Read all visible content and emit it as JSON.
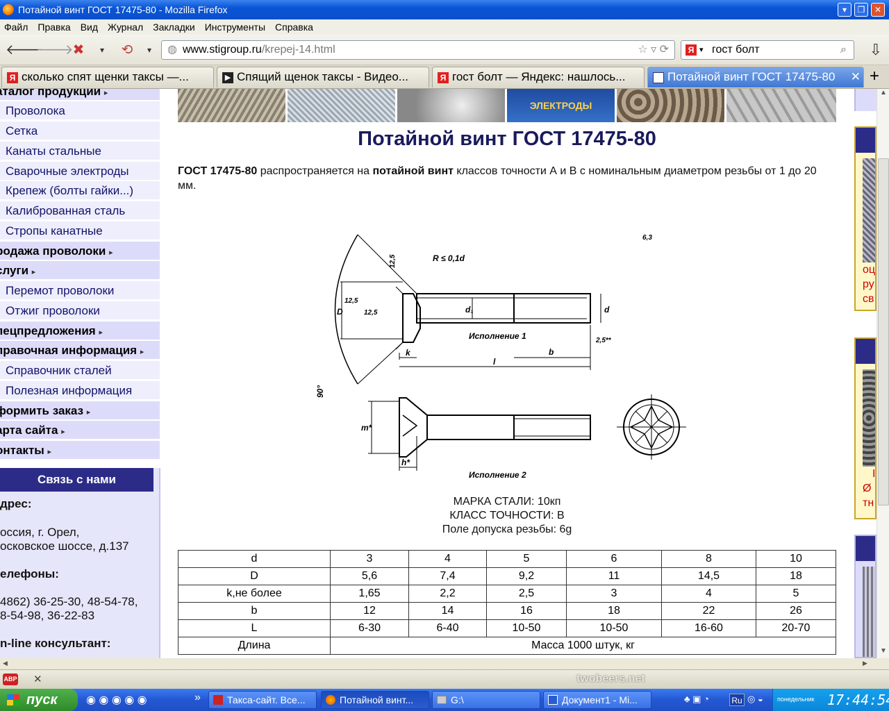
{
  "window": {
    "title": "Потайной винт ГОСТ 17475-80 - Mozilla Firefox"
  },
  "menu": [
    "Файл",
    "Правка",
    "Вид",
    "Журнал",
    "Закладки",
    "Инструменты",
    "Справка"
  ],
  "url": {
    "domain": "www.stigroup.ru",
    "path": "/krepej-14.html"
  },
  "search": {
    "value": "гост болт",
    "engine_glyph": "Я"
  },
  "tabs": [
    {
      "label": "сколько спят щенки таксы —..."
    },
    {
      "label": "Спящий щенок таксы - Видео..."
    },
    {
      "label": "гост болт — Яндекс: нашлось..."
    },
    {
      "label": "Потайной винт ГОСТ 17475-80"
    }
  ],
  "sidebar": [
    {
      "label": "аталог продукции",
      "type": "head"
    },
    {
      "label": "Проволока",
      "type": "sub"
    },
    {
      "label": "Сетка",
      "type": "sub"
    },
    {
      "label": "Канаты стальные",
      "type": "sub"
    },
    {
      "label": "Сварочные электроды",
      "type": "sub"
    },
    {
      "label": "Крепеж (болты гайки...)",
      "type": "sub"
    },
    {
      "label": "Калиброванная сталь",
      "type": "sub"
    },
    {
      "label": "Стропы канатные",
      "type": "sub"
    },
    {
      "label": "родажа проволоки",
      "type": "head"
    },
    {
      "label": "слуги",
      "type": "head"
    },
    {
      "label": "Перемот проволоки",
      "type": "sub"
    },
    {
      "label": "Отжиг проволоки",
      "type": "sub"
    },
    {
      "label": "пецпредложения",
      "type": "head"
    },
    {
      "label": "правочная информация",
      "type": "head"
    },
    {
      "label": "Справочник сталей",
      "type": "sub"
    },
    {
      "label": "Полезная информация",
      "type": "sub"
    },
    {
      "label": "формить заказ",
      "type": "head"
    },
    {
      "label": "арта сайта",
      "type": "head"
    },
    {
      "label": "онтакты",
      "type": "head"
    }
  ],
  "contact": {
    "heading": "Связь с нами",
    "address_label": "дрес:",
    "address_line1": "оссия, г. Орел,",
    "address_line2": "осковское шоссе, д.137",
    "phones_label": "елефоны:",
    "phones_line1": "4862) 36-25-30, 48-54-78,",
    "phones_line2": "8-54-98, 36-22-83",
    "online_label": "n-line консультант:"
  },
  "banner": {
    "electrode_text": "ЭЛЕКТРОДЫ"
  },
  "main": {
    "title": "Потайной винт ГОСТ 17475-80",
    "intro_b1": "ГОСТ 17475-80",
    "intro_t1": " распространяется на ",
    "intro_b2": "потайной винт",
    "intro_t2": " классов точности А и В с номинальным диаметром резьбы от 1 до 20 мм.",
    "steel": "МАРКА СТАЛИ: 10кп",
    "accuracy": "КЛАСС ТОЧНОСТИ: В",
    "tolerance": "Поле допуска резьбы: 6g"
  },
  "drawing": {
    "exec1": "Исполнение 1",
    "exec2": "Исполнение 2",
    "radius": "R ≤ 0,1d",
    "rough": "6,3",
    "angle": "90°",
    "r125a": "12,5",
    "r125b": "12,5",
    "r125c": "12,5",
    "lbl_D": "D",
    "lbl_d1": "d₁",
    "lbl_d": "d",
    "lbl_k": "k",
    "lbl_b": "b",
    "lbl_l": "l",
    "lbl_m": "m*",
    "lbl_h": "h*",
    "chamfer": "2,5**"
  },
  "table": {
    "rows": [
      [
        "d",
        "3",
        "4",
        "5",
        "6",
        "8",
        "10"
      ],
      [
        "D",
        "5,6",
        "7,4",
        "9,2",
        "11",
        "14,5",
        "18"
      ],
      [
        "k,не более",
        "1,65",
        "2,2",
        "2,5",
        "3",
        "4",
        "5"
      ],
      [
        "b",
        "12",
        "14",
        "16",
        "18",
        "22",
        "26"
      ],
      [
        "L",
        "6-30",
        "6-40",
        "10-50",
        "10-50",
        "16-60",
        "20-70"
      ]
    ],
    "mass_label": "Длина",
    "mass_value": "Масса 1000 штук, кг"
  },
  "right_strip": {
    "t1": "оц",
    "t2": "ру",
    "t3": "св",
    "t4": "I",
    "t5": "Ø",
    "t6": "тн"
  },
  "addon": {
    "abp": "ABP",
    "brand": "twobeers.net"
  },
  "taskbar": {
    "start": "пуск",
    "more": "»",
    "tasks": [
      {
        "label": "Такса-сайт. Все..."
      },
      {
        "label": "Потайной винт..."
      },
      {
        "label": "G:\\"
      },
      {
        "label": "Документ1 - Mi..."
      }
    ],
    "lang": "Ru",
    "day": "понедельник",
    "time": "17:44:54"
  }
}
